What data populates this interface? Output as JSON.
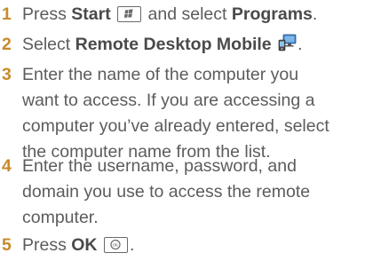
{
  "steps": [
    {
      "number": "1",
      "parts": [
        "Press ",
        "Start",
        " and select ",
        "Programs",
        "."
      ],
      "key_icon": "windows-start-key-icon"
    },
    {
      "number": "2",
      "parts": [
        "Select ",
        "Remote Desktop Mobile",
        "."
      ],
      "app_icon": "remote-desktop-mobile-icon"
    },
    {
      "number": "3",
      "lines": [
        "Enter the name of the computer you",
        "want to access. If you are accessing a",
        "computer you’ve already entered, select",
        "the computer name from the list."
      ]
    },
    {
      "number": "4",
      "lines": [
        "Enter the username, password, and",
        "domain you use to access the remote",
        "computer."
      ]
    },
    {
      "number": "5",
      "parts": [
        "Press ",
        "OK",
        "."
      ],
      "key_icon": "ok-key-icon"
    }
  ],
  "colors": {
    "step_number": "#c98a2a",
    "text": "#5c5c5c"
  }
}
